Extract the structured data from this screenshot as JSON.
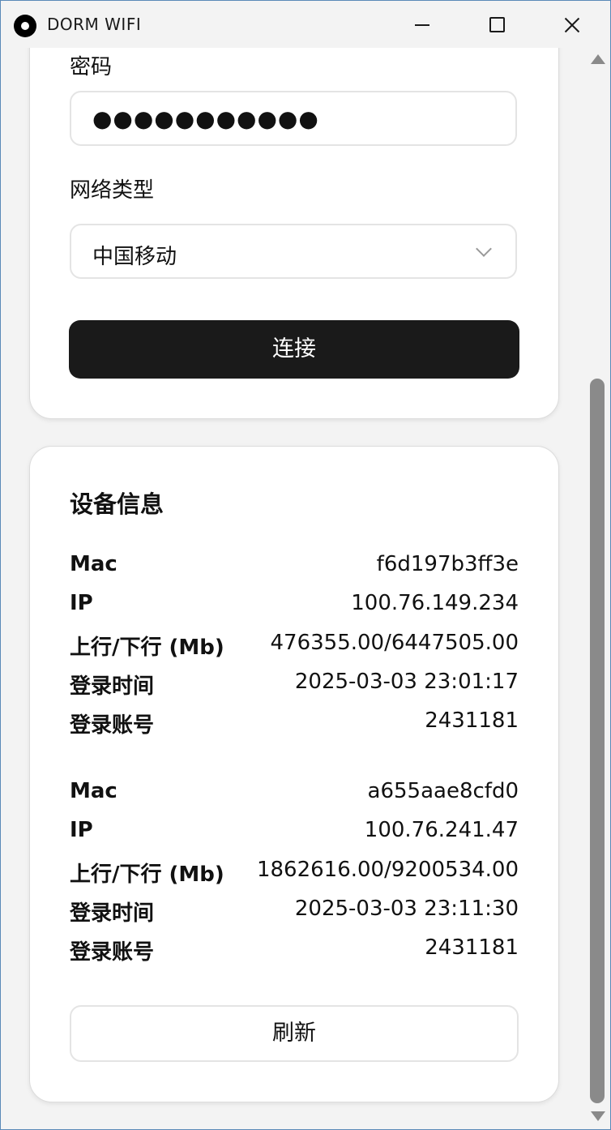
{
  "window": {
    "title": "DORM WIFI"
  },
  "login": {
    "password_label": "密码",
    "password_value": "●●●●●●●●●●●",
    "network_label": "网络类型",
    "network_value": "中国移动",
    "connect_label": "连接"
  },
  "device_info": {
    "title": "设备信息",
    "devices": [
      {
        "mac_label": "Mac",
        "mac": "f6d197b3ff3e",
        "ip_label": "IP",
        "ip": "100.76.149.234",
        "traffic_label": "上行/下行 (Mb)",
        "traffic": "476355.00/6447505.00",
        "login_time_label": "登录时间",
        "login_time": "2025-03-03 23:01:17",
        "account_label": "登录账号",
        "account": "2431181"
      },
      {
        "mac_label": "Mac",
        "mac": "a655aae8cfd0",
        "ip_label": "IP",
        "ip": "100.76.241.47",
        "traffic_label": "上行/下行 (Mb)",
        "traffic": "1862616.00/9200534.00",
        "login_time_label": "登录时间",
        "login_time": "2025-03-03 23:11:30",
        "account_label": "登录账号",
        "account": "2431181"
      }
    ],
    "refresh_label": "刷新"
  }
}
